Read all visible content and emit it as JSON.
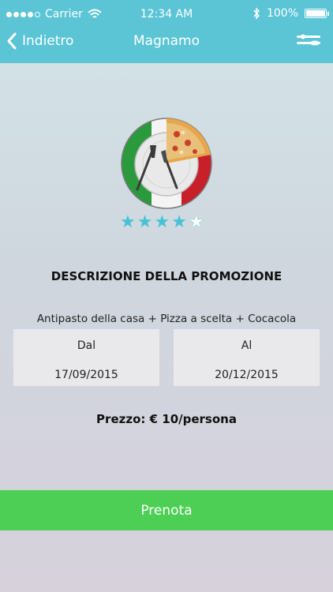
{
  "status_bar": {
    "carrier": "Carrier",
    "time": "12:34 AM",
    "battery": "100%",
    "battery_level": 1.0,
    "signal_dots_filled": 4,
    "signal_dots_total": 5,
    "icons": [
      "wifi-icon",
      "bluetooth-icon",
      "battery-icon"
    ]
  },
  "nav": {
    "back_label": "Indietro",
    "title": "Magnamo",
    "back_icon": "chevron-left-icon",
    "menu_icon": "cutlery-menu-icon"
  },
  "restaurant": {
    "logo_icon": "italian-plate-pizza-logo",
    "rating": 4,
    "rating_max": 5
  },
  "promotion": {
    "heading": "DESCRIZIONE DELLA PROMOZIONE",
    "description": "Antipasto della casa + Pizza a scelta + Cocacola",
    "from_label": "Dal",
    "from_date": "17/09/2015",
    "to_label": "Al",
    "to_date": "20/12/2015",
    "price": "Prezzo: € 10/persona"
  },
  "action": {
    "book_label": "Prenota"
  },
  "colors": {
    "accent": "#5bc4d5",
    "button": "#4ccf54",
    "star": "#43c3d5"
  }
}
